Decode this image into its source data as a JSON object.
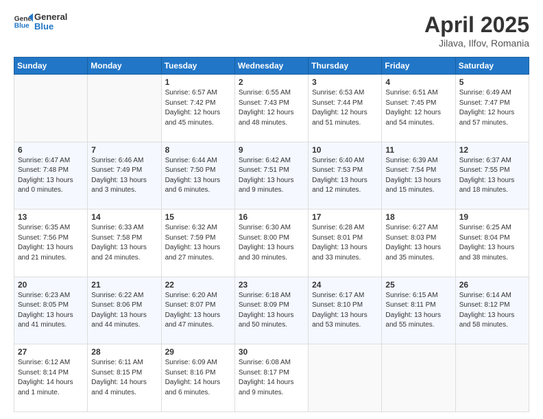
{
  "header": {
    "logo_general": "General",
    "logo_blue": "Blue",
    "title": "April 2025",
    "subtitle": "Jilava, Ilfov, Romania"
  },
  "columns": [
    "Sunday",
    "Monday",
    "Tuesday",
    "Wednesday",
    "Thursday",
    "Friday",
    "Saturday"
  ],
  "weeks": [
    [
      {
        "day": "",
        "info": ""
      },
      {
        "day": "",
        "info": ""
      },
      {
        "day": "1",
        "info": "Sunrise: 6:57 AM\nSunset: 7:42 PM\nDaylight: 12 hours\nand 45 minutes."
      },
      {
        "day": "2",
        "info": "Sunrise: 6:55 AM\nSunset: 7:43 PM\nDaylight: 12 hours\nand 48 minutes."
      },
      {
        "day": "3",
        "info": "Sunrise: 6:53 AM\nSunset: 7:44 PM\nDaylight: 12 hours\nand 51 minutes."
      },
      {
        "day": "4",
        "info": "Sunrise: 6:51 AM\nSunset: 7:45 PM\nDaylight: 12 hours\nand 54 minutes."
      },
      {
        "day": "5",
        "info": "Sunrise: 6:49 AM\nSunset: 7:47 PM\nDaylight: 12 hours\nand 57 minutes."
      }
    ],
    [
      {
        "day": "6",
        "info": "Sunrise: 6:47 AM\nSunset: 7:48 PM\nDaylight: 13 hours\nand 0 minutes."
      },
      {
        "day": "7",
        "info": "Sunrise: 6:46 AM\nSunset: 7:49 PM\nDaylight: 13 hours\nand 3 minutes."
      },
      {
        "day": "8",
        "info": "Sunrise: 6:44 AM\nSunset: 7:50 PM\nDaylight: 13 hours\nand 6 minutes."
      },
      {
        "day": "9",
        "info": "Sunrise: 6:42 AM\nSunset: 7:51 PM\nDaylight: 13 hours\nand 9 minutes."
      },
      {
        "day": "10",
        "info": "Sunrise: 6:40 AM\nSunset: 7:53 PM\nDaylight: 13 hours\nand 12 minutes."
      },
      {
        "day": "11",
        "info": "Sunrise: 6:39 AM\nSunset: 7:54 PM\nDaylight: 13 hours\nand 15 minutes."
      },
      {
        "day": "12",
        "info": "Sunrise: 6:37 AM\nSunset: 7:55 PM\nDaylight: 13 hours\nand 18 minutes."
      }
    ],
    [
      {
        "day": "13",
        "info": "Sunrise: 6:35 AM\nSunset: 7:56 PM\nDaylight: 13 hours\nand 21 minutes."
      },
      {
        "day": "14",
        "info": "Sunrise: 6:33 AM\nSunset: 7:58 PM\nDaylight: 13 hours\nand 24 minutes."
      },
      {
        "day": "15",
        "info": "Sunrise: 6:32 AM\nSunset: 7:59 PM\nDaylight: 13 hours\nand 27 minutes."
      },
      {
        "day": "16",
        "info": "Sunrise: 6:30 AM\nSunset: 8:00 PM\nDaylight: 13 hours\nand 30 minutes."
      },
      {
        "day": "17",
        "info": "Sunrise: 6:28 AM\nSunset: 8:01 PM\nDaylight: 13 hours\nand 33 minutes."
      },
      {
        "day": "18",
        "info": "Sunrise: 6:27 AM\nSunset: 8:03 PM\nDaylight: 13 hours\nand 35 minutes."
      },
      {
        "day": "19",
        "info": "Sunrise: 6:25 AM\nSunset: 8:04 PM\nDaylight: 13 hours\nand 38 minutes."
      }
    ],
    [
      {
        "day": "20",
        "info": "Sunrise: 6:23 AM\nSunset: 8:05 PM\nDaylight: 13 hours\nand 41 minutes."
      },
      {
        "day": "21",
        "info": "Sunrise: 6:22 AM\nSunset: 8:06 PM\nDaylight: 13 hours\nand 44 minutes."
      },
      {
        "day": "22",
        "info": "Sunrise: 6:20 AM\nSunset: 8:07 PM\nDaylight: 13 hours\nand 47 minutes."
      },
      {
        "day": "23",
        "info": "Sunrise: 6:18 AM\nSunset: 8:09 PM\nDaylight: 13 hours\nand 50 minutes."
      },
      {
        "day": "24",
        "info": "Sunrise: 6:17 AM\nSunset: 8:10 PM\nDaylight: 13 hours\nand 53 minutes."
      },
      {
        "day": "25",
        "info": "Sunrise: 6:15 AM\nSunset: 8:11 PM\nDaylight: 13 hours\nand 55 minutes."
      },
      {
        "day": "26",
        "info": "Sunrise: 6:14 AM\nSunset: 8:12 PM\nDaylight: 13 hours\nand 58 minutes."
      }
    ],
    [
      {
        "day": "27",
        "info": "Sunrise: 6:12 AM\nSunset: 8:14 PM\nDaylight: 14 hours\nand 1 minute."
      },
      {
        "day": "28",
        "info": "Sunrise: 6:11 AM\nSunset: 8:15 PM\nDaylight: 14 hours\nand 4 minutes."
      },
      {
        "day": "29",
        "info": "Sunrise: 6:09 AM\nSunset: 8:16 PM\nDaylight: 14 hours\nand 6 minutes."
      },
      {
        "day": "30",
        "info": "Sunrise: 6:08 AM\nSunset: 8:17 PM\nDaylight: 14 hours\nand 9 minutes."
      },
      {
        "day": "",
        "info": ""
      },
      {
        "day": "",
        "info": ""
      },
      {
        "day": "",
        "info": ""
      }
    ]
  ]
}
